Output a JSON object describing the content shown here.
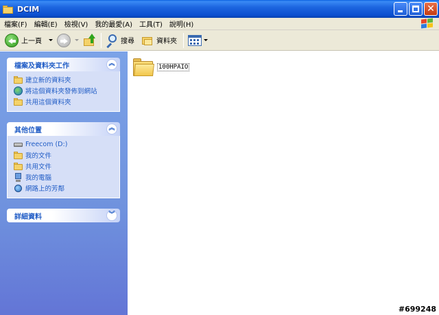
{
  "window": {
    "title": "DCIM"
  },
  "menu": {
    "items": [
      "檔案(F)",
      "編輯(E)",
      "檢視(V)",
      "我的最愛(A)",
      "工具(T)",
      "說明(H)"
    ]
  },
  "toolbar": {
    "back_label": "上一頁",
    "search_label": "搜尋",
    "folders_label": "資料夾"
  },
  "sidebar": {
    "file_tasks": {
      "title": "檔案及資料夾工作",
      "items": [
        "建立新的資料夾",
        "將這個資料夾發佈到網站",
        "共用這個資料夾"
      ]
    },
    "other_places": {
      "title": "其他位置",
      "items": [
        "Freecom (D:)",
        "我的文件",
        "共用文件",
        "我的電腦",
        "網路上的芳鄰"
      ]
    },
    "details": {
      "title": "詳細資料"
    }
  },
  "content": {
    "items": [
      {
        "name": "100HPAIO",
        "icon": "folder-icon"
      }
    ]
  },
  "watermark": "#699248",
  "colors": {
    "titlebar": "#0b4fd0",
    "sidebar_bg": "#7ba2e7",
    "link": "#215dc6"
  }
}
